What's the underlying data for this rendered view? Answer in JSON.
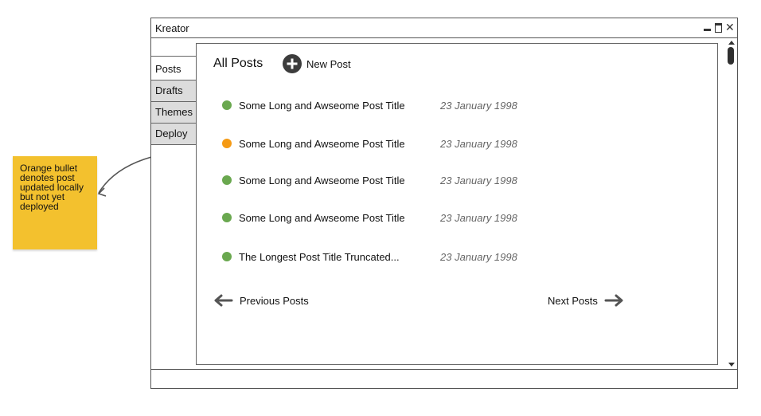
{
  "window": {
    "title": "Kreator"
  },
  "tabs": [
    {
      "label": "Posts",
      "active": true
    },
    {
      "label": "Drafts",
      "active": false
    },
    {
      "label": "Themes",
      "active": false
    },
    {
      "label": "Deploy",
      "active": false
    }
  ],
  "header": {
    "title": "All Posts",
    "new_post_label": "New Post"
  },
  "posts": [
    {
      "title": "Some Long and  Awseome Post Title",
      "date": "23 January 1998",
      "status": "deployed"
    },
    {
      "title": "Some Long and  Awseome Post Title",
      "date": "23 January 1998",
      "status": "updated-locally"
    },
    {
      "title": "Some Long and  Awseome Post Title",
      "date": "23 January 1998",
      "status": "deployed"
    },
    {
      "title": "Some Long and  Awseome Post Title",
      "date": "23 January 1998",
      "status": "deployed"
    },
    {
      "title": "The Longest Post Title Truncated...",
      "date": "23 January 1998",
      "status": "deployed"
    }
  ],
  "pagination": {
    "previous_label": "Previous Posts",
    "next_label": "Next Posts"
  },
  "annotation": {
    "text": "Orange bullet denotes post updated locally but not yet deployed"
  },
  "colors": {
    "deployed": "#6aa84f",
    "updated_locally": "#f59a14",
    "sticky_note": "#f3c12e"
  }
}
